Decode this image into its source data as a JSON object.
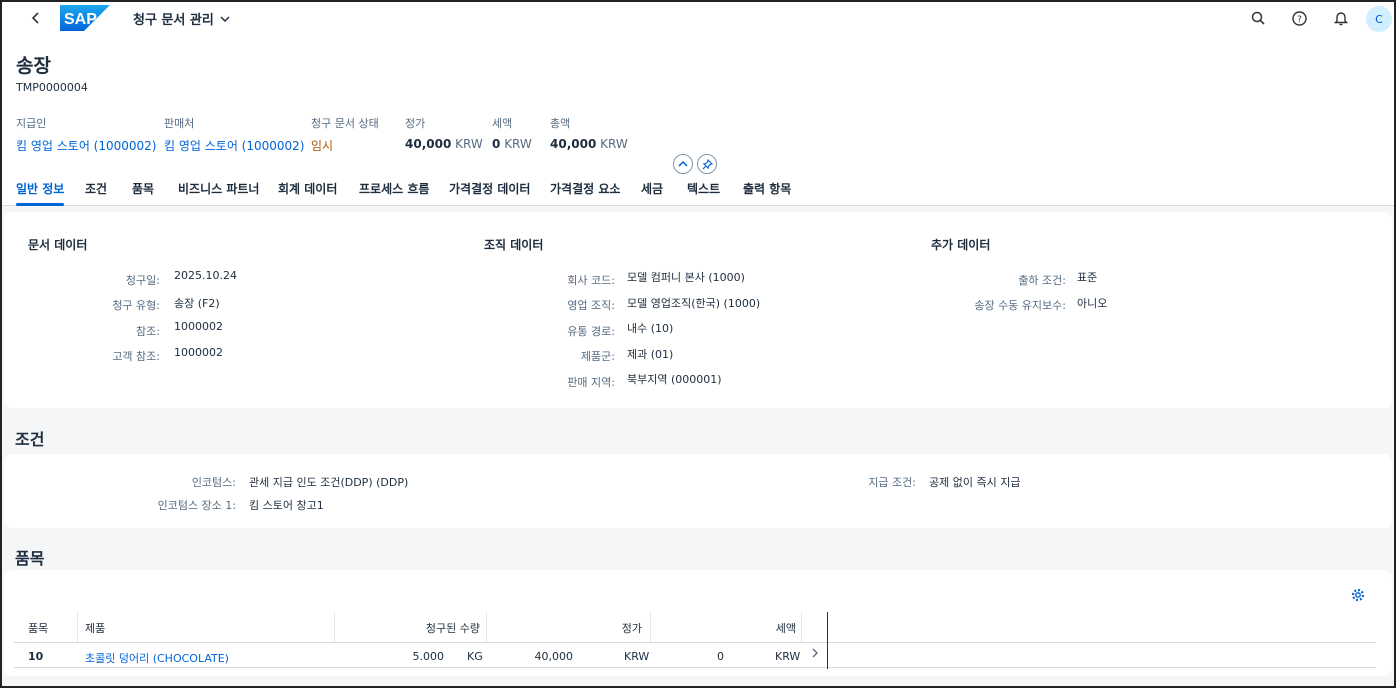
{
  "shell": {
    "app_title": "청구 문서 관리",
    "avatar_initial": "C"
  },
  "header": {
    "title": "송장",
    "subtitle": "TMP0000004",
    "fields": [
      {
        "label": "지급인",
        "value": "킴 영업 스토어 (1000002)"
      },
      {
        "label": "판매처",
        "value": "킴 영업 스토어 (1000002)"
      },
      {
        "label": "청구 문서 상태",
        "value": "임시"
      },
      {
        "label": "정가",
        "amount": "40,000",
        "unit": "KRW"
      },
      {
        "label": "세액",
        "amount": "0",
        "unit": "KRW"
      },
      {
        "label": "총액",
        "amount": "40,000",
        "unit": "KRW"
      }
    ]
  },
  "tabs": [
    "일반 정보",
    "조건",
    "품목",
    "비즈니스 파트너",
    "회계 데이터",
    "프로세스 흐름",
    "가격결정 데이터",
    "가격결정 요소",
    "세금",
    "텍스트",
    "출력 항목"
  ],
  "general": {
    "doc_data": {
      "title": "문서 데이터",
      "rows": [
        {
          "label": "청구일:",
          "value": "2025.10.24"
        },
        {
          "label": "청구 유형:",
          "value": "송장 (F2)"
        },
        {
          "label": "참조:",
          "value": "1000002"
        },
        {
          "label": "고객 참조:",
          "value": "1000002"
        }
      ]
    },
    "org_data": {
      "title": "조직 데이터",
      "rows": [
        {
          "label": "회사 코드:",
          "value": "모델 컴퍼니 본사 (1000)"
        },
        {
          "label": "영업 조직:",
          "value": "모델 영업조직(한국) (1000)"
        },
        {
          "label": "유통 경로:",
          "value": "내수 (10)"
        },
        {
          "label": "제품군:",
          "value": "제과 (01)"
        },
        {
          "label": "판매 지역:",
          "value": "북부지역 (000001)"
        }
      ]
    },
    "extra_data": {
      "title": "추가 데이터",
      "rows": [
        {
          "label": "출하 조건:",
          "value": "표준"
        },
        {
          "label": "송장 수동 유지보수:",
          "value": "아니오"
        }
      ]
    }
  },
  "conditions": {
    "title": "조건",
    "incoterms_label": "인코텀스:",
    "incoterms_value": "관세 지급 인도 조건(DDP) (DDP)",
    "incoterms_loc_label": "인코텀스 장소 1:",
    "incoterms_loc_value": "킴 스토어 창고1",
    "payment_label": "지급 조건:",
    "payment_value": "공제 없이 즉시 지급"
  },
  "items": {
    "title": "품목",
    "columns": [
      "품목",
      "제품",
      "청구된 수량",
      "정가",
      "세액"
    ],
    "rows": [
      {
        "item": "10",
        "product": "초콜릿 덩어리 (CHOCOLATE)",
        "qty": "5.000",
        "qty_unit": "KG",
        "price": "40,000",
        "price_unit": "KRW",
        "tax": "0",
        "tax_unit": "KRW"
      }
    ]
  }
}
